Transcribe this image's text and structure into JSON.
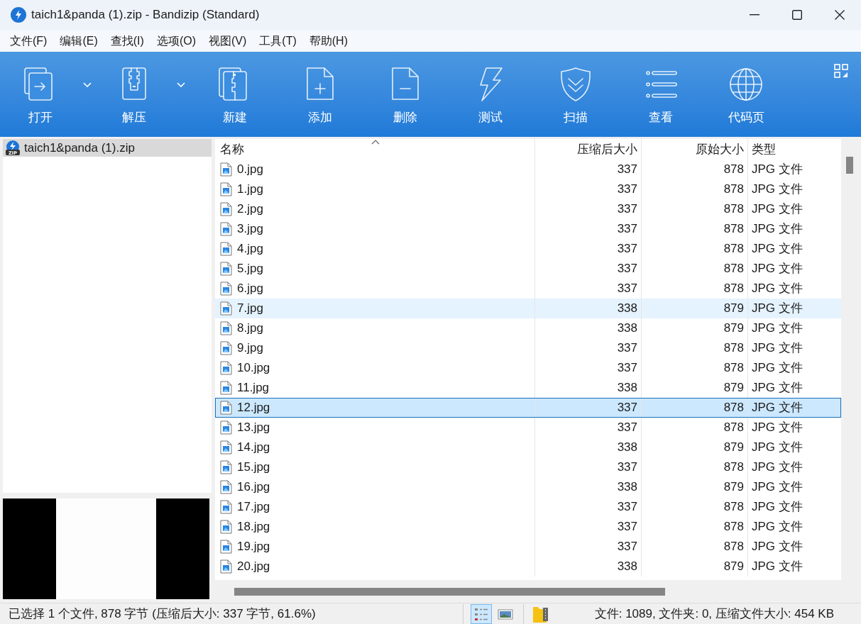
{
  "window": {
    "title": "taich1&panda (1).zip - Bandizip (Standard)"
  },
  "menu": [
    "文件(F)",
    "编辑(E)",
    "查找(I)",
    "选项(O)",
    "视图(V)",
    "工具(T)",
    "帮助(H)"
  ],
  "toolbar": [
    {
      "label": "打开",
      "dropdown": true
    },
    {
      "label": "解压",
      "dropdown": true
    },
    {
      "label": "新建",
      "dropdown": false
    },
    {
      "label": "添加",
      "dropdown": false
    },
    {
      "label": "删除",
      "dropdown": false
    },
    {
      "label": "测试",
      "dropdown": false
    },
    {
      "label": "扫描",
      "dropdown": false
    },
    {
      "label": "查看",
      "dropdown": false
    },
    {
      "label": "代码页",
      "dropdown": false
    }
  ],
  "tree": {
    "items": [
      {
        "label": "taich1&panda (1).zip",
        "badge": "ZIP",
        "selected": true
      }
    ]
  },
  "table": {
    "columns": [
      "名称",
      "压缩后大小",
      "原始大小",
      "类型"
    ],
    "rows": [
      {
        "name": "0.jpg",
        "packed": "337",
        "size": "878",
        "type": "JPG 文件",
        "selected": false,
        "hovered": false
      },
      {
        "name": "1.jpg",
        "packed": "337",
        "size": "878",
        "type": "JPG 文件",
        "selected": false,
        "hovered": false
      },
      {
        "name": "2.jpg",
        "packed": "337",
        "size": "878",
        "type": "JPG 文件",
        "selected": false,
        "hovered": false
      },
      {
        "name": "3.jpg",
        "packed": "337",
        "size": "878",
        "type": "JPG 文件",
        "selected": false,
        "hovered": false
      },
      {
        "name": "4.jpg",
        "packed": "337",
        "size": "878",
        "type": "JPG 文件",
        "selected": false,
        "hovered": false
      },
      {
        "name": "5.jpg",
        "packed": "337",
        "size": "878",
        "type": "JPG 文件",
        "selected": false,
        "hovered": false
      },
      {
        "name": "6.jpg",
        "packed": "337",
        "size": "878",
        "type": "JPG 文件",
        "selected": false,
        "hovered": false
      },
      {
        "name": "7.jpg",
        "packed": "338",
        "size": "879",
        "type": "JPG 文件",
        "selected": false,
        "hovered": true
      },
      {
        "name": "8.jpg",
        "packed": "338",
        "size": "879",
        "type": "JPG 文件",
        "selected": false,
        "hovered": false
      },
      {
        "name": "9.jpg",
        "packed": "337",
        "size": "878",
        "type": "JPG 文件",
        "selected": false,
        "hovered": false
      },
      {
        "name": "10.jpg",
        "packed": "337",
        "size": "878",
        "type": "JPG 文件",
        "selected": false,
        "hovered": false
      },
      {
        "name": "11.jpg",
        "packed": "338",
        "size": "879",
        "type": "JPG 文件",
        "selected": false,
        "hovered": false
      },
      {
        "name": "12.jpg",
        "packed": "337",
        "size": "878",
        "type": "JPG 文件",
        "selected": true,
        "hovered": false
      },
      {
        "name": "13.jpg",
        "packed": "337",
        "size": "878",
        "type": "JPG 文件",
        "selected": false,
        "hovered": false
      },
      {
        "name": "14.jpg",
        "packed": "338",
        "size": "879",
        "type": "JPG 文件",
        "selected": false,
        "hovered": false
      },
      {
        "name": "15.jpg",
        "packed": "337",
        "size": "878",
        "type": "JPG 文件",
        "selected": false,
        "hovered": false
      },
      {
        "name": "16.jpg",
        "packed": "338",
        "size": "879",
        "type": "JPG 文件",
        "selected": false,
        "hovered": false
      },
      {
        "name": "17.jpg",
        "packed": "337",
        "size": "878",
        "type": "JPG 文件",
        "selected": false,
        "hovered": false
      },
      {
        "name": "18.jpg",
        "packed": "337",
        "size": "878",
        "type": "JPG 文件",
        "selected": false,
        "hovered": false
      },
      {
        "name": "19.jpg",
        "packed": "337",
        "size": "878",
        "type": "JPG 文件",
        "selected": false,
        "hovered": false
      },
      {
        "name": "20.jpg",
        "packed": "338",
        "size": "879",
        "type": "JPG 文件",
        "selected": false,
        "hovered": false
      }
    ]
  },
  "status_bar": {
    "selection": "已选择 1 个文件, 878 字节 (压缩后大小: 337 字节, 61.6%)",
    "views": [
      {
        "selected": true
      },
      {
        "selected": false
      }
    ],
    "summary": "文件: 1089, 文件夹: 0, 压缩文件大小: 454 KB"
  }
}
